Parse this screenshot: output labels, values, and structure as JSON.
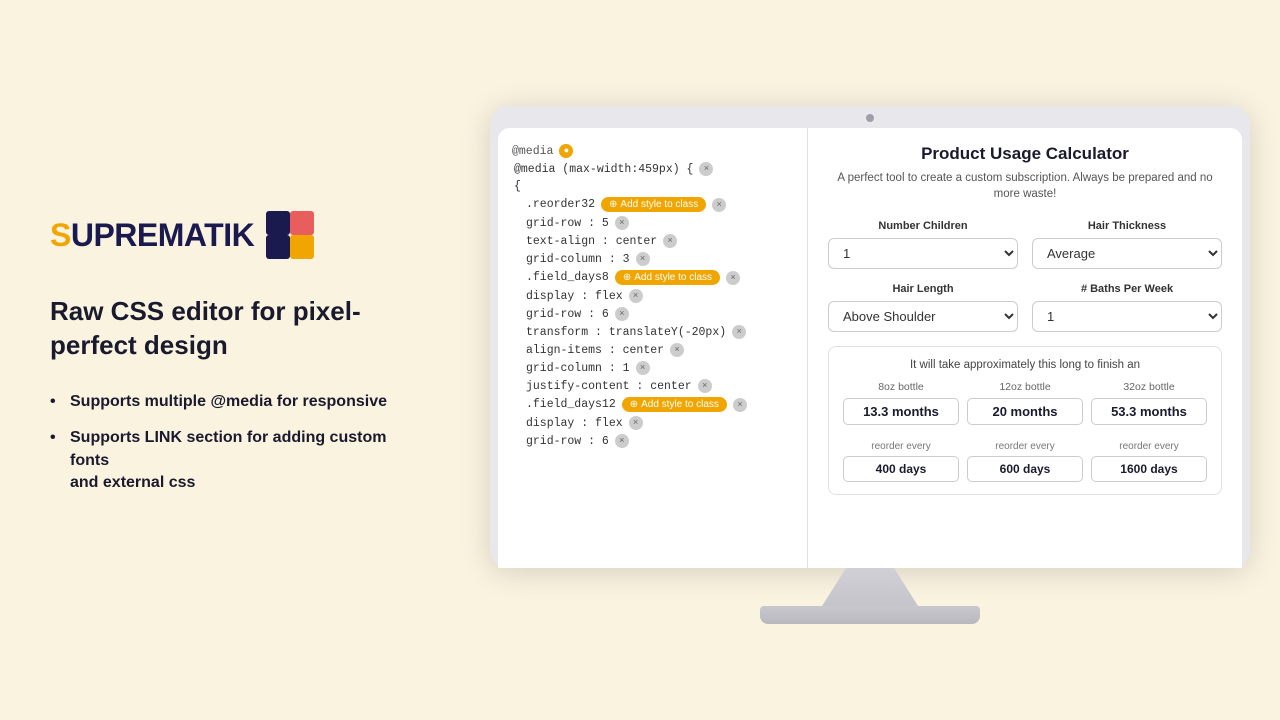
{
  "brand": {
    "name_prefix": "S",
    "name_rest": "UPREMATIK",
    "icon_alt": "Suprematik logo icon"
  },
  "tagline": "Raw CSS editor for pixel-perfect design",
  "features": [
    "Supports multiple @media for responsive",
    "Supports LINK section for adding custom fonts\nand external css"
  ],
  "code_editor": {
    "lines": [
      {
        "text": "@media",
        "type": "at-media",
        "badge": true
      },
      {
        "text": "@media (max-width:459px) {",
        "type": "indent",
        "has_x": true
      },
      {
        "text": "{",
        "type": "indent"
      },
      {
        "text": ".reorder32",
        "type": "indent2",
        "has_add": true,
        "has_x": true
      },
      {
        "text": "grid-row : 5",
        "type": "indent2",
        "has_x": true
      },
      {
        "text": "text-align : center",
        "type": "indent2",
        "has_x": true
      },
      {
        "text": "grid-column : 3",
        "type": "indent2",
        "has_x": true
      },
      {
        "text": ".field_days8",
        "type": "indent2",
        "has_add": true,
        "has_x": true
      },
      {
        "text": "display : flex",
        "type": "indent2",
        "has_x": true
      },
      {
        "text": "grid-row : 6",
        "type": "indent2",
        "has_x": true
      },
      {
        "text": "transform : translateY(-20px)",
        "type": "indent2",
        "has_x": true
      },
      {
        "text": "align-items : center",
        "type": "indent2",
        "has_x": true
      },
      {
        "text": "grid-column : 1",
        "type": "indent2",
        "has_x": true
      },
      {
        "text": "justify-content : center",
        "type": "indent2",
        "has_x": true
      },
      {
        "text": ".field_days12",
        "type": "indent2",
        "has_add": true,
        "has_x": true
      },
      {
        "text": "display : flex",
        "type": "indent2",
        "has_x": true
      },
      {
        "text": "grid-row : 6",
        "type": "indent2",
        "has_x": true
      }
    ],
    "add_style_label": "Add style to class"
  },
  "calculator": {
    "title": "Product Usage Calculator",
    "subtitle": "A perfect tool to create a custom subscription. Always be prepared and no more waste!",
    "fields": {
      "number_children": {
        "label": "Number Children",
        "value": "1"
      },
      "hair_thickness": {
        "label": "Hair Thickness",
        "value": "Average"
      },
      "hair_length": {
        "label": "Hair Length",
        "value": "Above Shoulder"
      },
      "baths_per_week": {
        "label": "# Baths Per Week",
        "value": "1"
      }
    },
    "result": {
      "intro": "It will take approximately this long to finish an",
      "columns": [
        {
          "size_label": "8oz bottle",
          "months": "13.3 months",
          "reorder_label": "reorder every",
          "reorder_days": "400 days"
        },
        {
          "size_label": "12oz bottle",
          "months": "20 months",
          "reorder_label": "reorder every",
          "reorder_days": "600 days"
        },
        {
          "size_label": "32oz bottle",
          "months": "53.3 months",
          "reorder_label": "reorder every",
          "reorder_days": "1600 days"
        }
      ]
    }
  }
}
